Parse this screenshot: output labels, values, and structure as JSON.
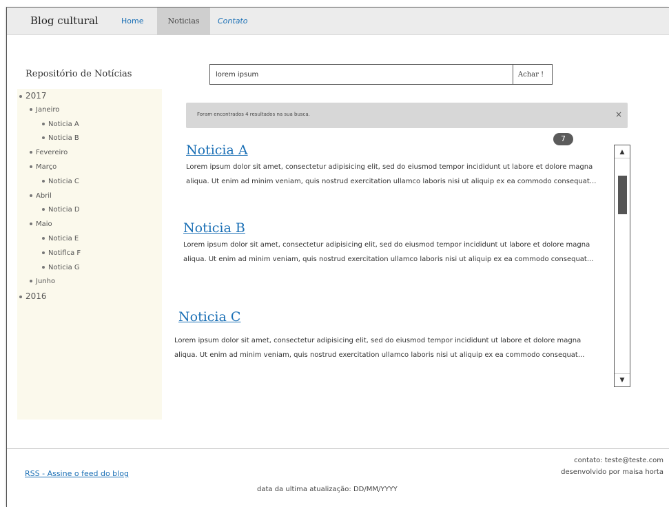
{
  "nav": {
    "brand": "Blog cultural",
    "items": [
      {
        "label": "Home"
      },
      {
        "label": "Noticias"
      },
      {
        "label": "Contato"
      }
    ]
  },
  "sidebar": {
    "title": "Repositório de Notícias",
    "tree": [
      {
        "label": "2017",
        "level": 0
      },
      {
        "label": "Janeiro",
        "level": 1
      },
      {
        "label": "Noticia A",
        "level": 2
      },
      {
        "label": "Noticia B",
        "level": 2
      },
      {
        "label": "Fevereiro",
        "level": 1
      },
      {
        "label": "Março",
        "level": 1
      },
      {
        "label": "Noticia C",
        "level": 2
      },
      {
        "label": "Abril",
        "level": 1
      },
      {
        "label": "Noticia D",
        "level": 2
      },
      {
        "label": "Maio",
        "level": 1
      },
      {
        "label": "Noticia E",
        "level": 2
      },
      {
        "label": "Notiflca F",
        "level": 2
      },
      {
        "label": "Noticia G",
        "level": 2
      },
      {
        "label": "Junho",
        "level": 1
      },
      {
        "label": "2016",
        "level": 0
      }
    ]
  },
  "search": {
    "value": "lorem ipsum",
    "button_label": "Achar !"
  },
  "alert": {
    "text": "Foram encontrados 4 resultados na sua busca.",
    "close_glyph": "×"
  },
  "results_badge": "7",
  "news": [
    {
      "title": "Noticia A",
      "body": "Lorem ipsum dolor sit amet, consectetur adipisicing elit, sed do eiusmod tempor incididunt ut labore et dolore magna aliqua. Ut enim ad minim veniam, quis nostrud exercitation ullamco laboris nisi ut aliquip ex ea commodo consequat..."
    },
    {
      "title": "Noticia B",
      "body": "Lorem ipsum dolor sit amet, consectetur adipisicing elit, sed do eiusmod tempor incididunt ut labore et dolore magna aliqua. Ut enim ad minim veniam, quis nostrud exercitation ullamco laboris nisi ut aliquip ex ea commodo consequat..."
    },
    {
      "title": "Noticia C",
      "body": "Lorem ipsum dolor sit amet, consectetur adipisicing elit, sed do eiusmod tempor incididunt ut labore et dolore magna aliqua. Ut enim ad minim veniam, quis nostrud exercitation ullamco laboris nisi ut aliquip ex ea commodo consequat..."
    }
  ],
  "scrollbar": {
    "up_glyph": "▲",
    "down_glyph": "▼"
  },
  "footer": {
    "rss": "RSS - Assine o feed do blog",
    "contact": "contato: teste@teste.com",
    "developer": "desenvolvido por maisa horta",
    "last_update": "data da ultima atualização: DD/MM/YYYY"
  },
  "colors": {
    "link": "#1a6fb5",
    "sidebar_bg": "#fbf9ec",
    "alert_bg": "#d7d7d7",
    "badge_bg": "#5b5b5b"
  }
}
